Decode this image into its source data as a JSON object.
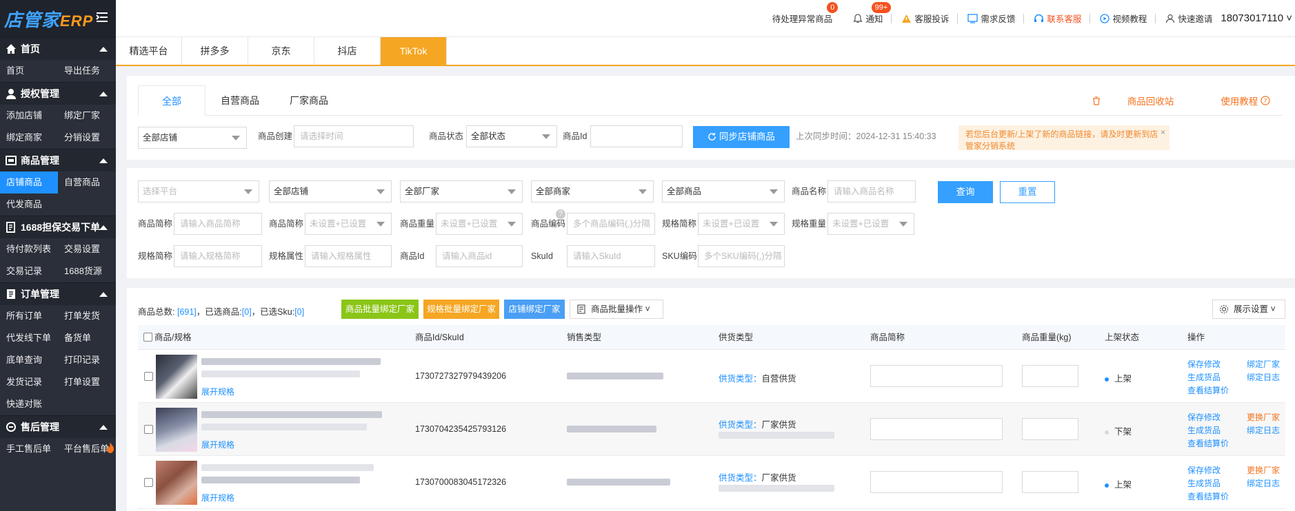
{
  "logo": {
    "text": "店管家",
    "suffix": "ERP"
  },
  "sidebar": {
    "sections": [
      {
        "title": "首页",
        "items": [
          "首页",
          "导出任务"
        ]
      },
      {
        "title": "授权管理",
        "items": [
          "添加店铺",
          "绑定厂家",
          "绑定商家",
          "分销设置"
        ]
      },
      {
        "title": "商品管理",
        "items": [
          "店铺商品",
          "自营商品",
          "代发商品"
        ]
      },
      {
        "title": "1688担保交易下单",
        "items": [
          "待付款列表",
          "交易设置",
          "交易记录",
          "1688货源"
        ]
      },
      {
        "title": "订单管理",
        "items": [
          "所有订单",
          "打单发货",
          "代发线下单",
          "备货单",
          "底单查询",
          "打印记录",
          "发货记录",
          "打单设置",
          "快递对账"
        ]
      },
      {
        "title": "售后管理",
        "items": [
          "手工售后单",
          "平台售后单"
        ]
      }
    ]
  },
  "topbar": {
    "abnormal": "待处理异常商品",
    "abnormal_badge": "0",
    "notify": "通知",
    "notify_badge": "99+",
    "complaint": "客服投诉",
    "feedback": "需求反馈",
    "contact": "联系客服",
    "video": "视频教程",
    "invite": "快速邀请",
    "user": "18073017110"
  },
  "platform_tabs": [
    "精选平台",
    "拼多多",
    "京东",
    "抖店",
    "TikTok"
  ],
  "sub_tabs": [
    "全部",
    "自营商品",
    "厂家商品"
  ],
  "right_links": {
    "recycle": "商品回收站",
    "tutorial": "使用教程"
  },
  "filter1": {
    "shop": "全部店铺",
    "create_label": "商品创建",
    "create_ph": "请选择时间",
    "status_label": "商品状态",
    "status": "全部状态",
    "id_label": "商品Id",
    "sync_btn": "同步店铺商品",
    "sync_time": "上次同步时间：2024-12-31 15:40:33",
    "notice": "若您后台更新/上架了新的商品链接，请及时更新到店管家分销系统",
    "notice_close": "×"
  },
  "filter2": {
    "platform_ph": "选择平台",
    "shop": "全部店铺",
    "factory": "全部厂家",
    "merchant": "全部商家",
    "goods": "全部商品",
    "name_label": "商品名称",
    "name_ph": "请输入商品名称",
    "query_btn": "查询",
    "reset_btn": "重置",
    "short_label": "商品简称",
    "short_ph": "请输入商品简称",
    "short2_label": "商品简称",
    "set_ph": "未设置+已设置",
    "weight_label": "商品重量",
    "code_label": "商品编码",
    "code_ph": "多个商品编码(,)分隔",
    "spec_short_label": "规格简称",
    "spec_weight_label": "规格重量",
    "spec_short2_label": "规格简称",
    "spec_short2_ph": "请输入规格简称",
    "spec_attr_label": "规格属性",
    "spec_attr_ph": "请输入规格属性",
    "pid_label": "商品Id",
    "pid_ph": "请输入商品id",
    "skuid_label": "SkuId",
    "skuid_ph": "请输入SkuId",
    "skucode_label": "SKU编码",
    "skucode_ph": "多个SKU编码(,)分隔",
    "qmark": "?"
  },
  "summary": {
    "total_label": "商品总数:",
    "total": "[691]",
    "sel_label": "，已选商品:",
    "sel": "[0]",
    "sku_label": "，已选Sku:",
    "sku": "[0]"
  },
  "actions": {
    "bind_factory": "商品批量绑定厂家",
    "spec_bind": "规格批量绑定厂家",
    "shop_bind": "店铺绑定厂家",
    "batch_op": "商品批量操作",
    "display": "展示设置"
  },
  "table": {
    "headers": [
      "商品/规格",
      "商品Id/SkuId",
      "销售类型",
      "供货类型",
      "商品简称",
      "商品重量(kg)",
      "上架状态",
      "操作"
    ],
    "expand": "展开规格",
    "supply_label": "供货类型：",
    "rows": [
      {
        "id": "1730727327979439206",
        "supply": "自营供货",
        "status": "上架",
        "status_color": "#1e90ff",
        "op1": "保存修改",
        "op2": "绑定厂家",
        "op3": "生成货品",
        "op4": "绑定日志",
        "op5": "查看结算价",
        "op2_color": "#1e90ff"
      },
      {
        "id": "1730704235425793126",
        "supply": "厂家供货",
        "status": "下架",
        "status_color": "#d9d9d9",
        "op1": "保存修改",
        "op2": "更换厂家",
        "op3": "生成货品",
        "op4": "绑定日志",
        "op5": "查看结算价",
        "op2_color": "#f5731e"
      },
      {
        "id": "1730700083045172326",
        "supply": "厂家供货",
        "status": "上架",
        "status_color": "#1e90ff",
        "op1": "保存修改",
        "op2": "更换厂家",
        "op3": "生成货品",
        "op4": "绑定日志",
        "op5": "查看结算价",
        "op2_color": "#f5731e"
      }
    ]
  },
  "colors": {
    "accent": "#1e90ff",
    "orange": "#f5a623",
    "sidebar": "#2b2f3a"
  }
}
